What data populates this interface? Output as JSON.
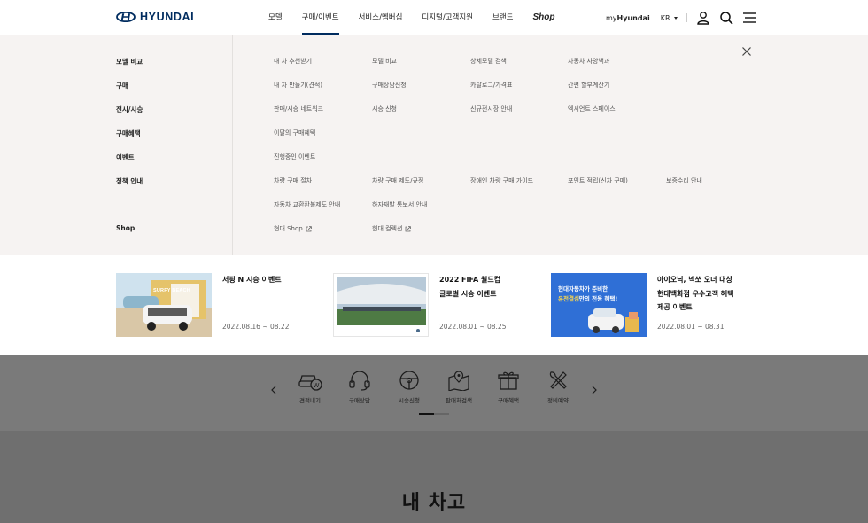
{
  "header": {
    "logo_text": "HYUNDAI",
    "nav": [
      {
        "label": "모델"
      },
      {
        "label": "구매/이벤트"
      },
      {
        "label": "서비스/멤버십"
      },
      {
        "label": "디지털/고객지원"
      },
      {
        "label": "브랜드"
      },
      {
        "label": "Shop"
      }
    ],
    "active_index": 1,
    "my_prefix": "my",
    "my_brand": "Hyundai",
    "lang": "KR"
  },
  "mega_menu": {
    "categories": [
      "모델 비교",
      "구매",
      "전시/시승",
      "구매혜택",
      "이벤트",
      "정책 안내",
      "Shop"
    ],
    "links": [
      [
        "내 차 추천받기",
        "모델 비교",
        "상세모델 검색",
        "자동차 사양백과"
      ],
      [
        "내 차 만들기(견적)",
        "구매상담신청",
        "카탈로그/가격표",
        "간편 할부계산기"
      ],
      [
        "판매/시승 네트워크",
        "시승 신청",
        "신규전시장 안내",
        "엑시언트 스페이스"
      ],
      [
        "이달의 구매혜택"
      ],
      [
        "진행중인 이벤트"
      ],
      [
        "차량 구매 절차",
        "차량 구매 제도/규정",
        "장애인 차량 구매 가이드",
        "포인트 적립(신차 구매)",
        "보증수리 안내"
      ],
      [
        "자동차 교환환불제도 안내",
        "하자재발 통보서 안내"
      ],
      [
        "현대 Shop",
        "현대 컬렉션"
      ]
    ]
  },
  "events": [
    {
      "title_lines": [
        "서핑 N 시승 이벤트"
      ],
      "date": "2022.08.16 ~ 08.22",
      "image_text": "SURFY BEACH"
    },
    {
      "title_lines": [
        "2022 FIFA 월드컵",
        "글로벌 시승 이벤트"
      ],
      "date": "2022.08.01 ~ 08.25"
    },
    {
      "title_lines": [
        "아이오닉, 넥쏘 오너 대상",
        "현대백화점 우수고객 혜택",
        "제공 이벤트"
      ],
      "date": "2022.08.01 ~ 08.31",
      "image_text": [
        "현대자동차가 준비한",
        "운전결심",
        "만의 전용 혜택!"
      ]
    }
  ],
  "quick_menu": [
    {
      "label": "견적내기",
      "icon": "car-estimate-icon"
    },
    {
      "label": "구매상담",
      "icon": "headset-icon"
    },
    {
      "label": "시승신청",
      "icon": "steering-wheel-icon"
    },
    {
      "label": "판매처검색",
      "icon": "map-pin-icon"
    },
    {
      "label": "구매혜택",
      "icon": "gift-icon"
    },
    {
      "label": "정비예약",
      "icon": "wrench-icon"
    }
  ],
  "section_title": "내 차고",
  "colors": {
    "brand": "#002c5f",
    "menu_bg": "#f6f3f2",
    "overlay": "#6f6f6f"
  }
}
